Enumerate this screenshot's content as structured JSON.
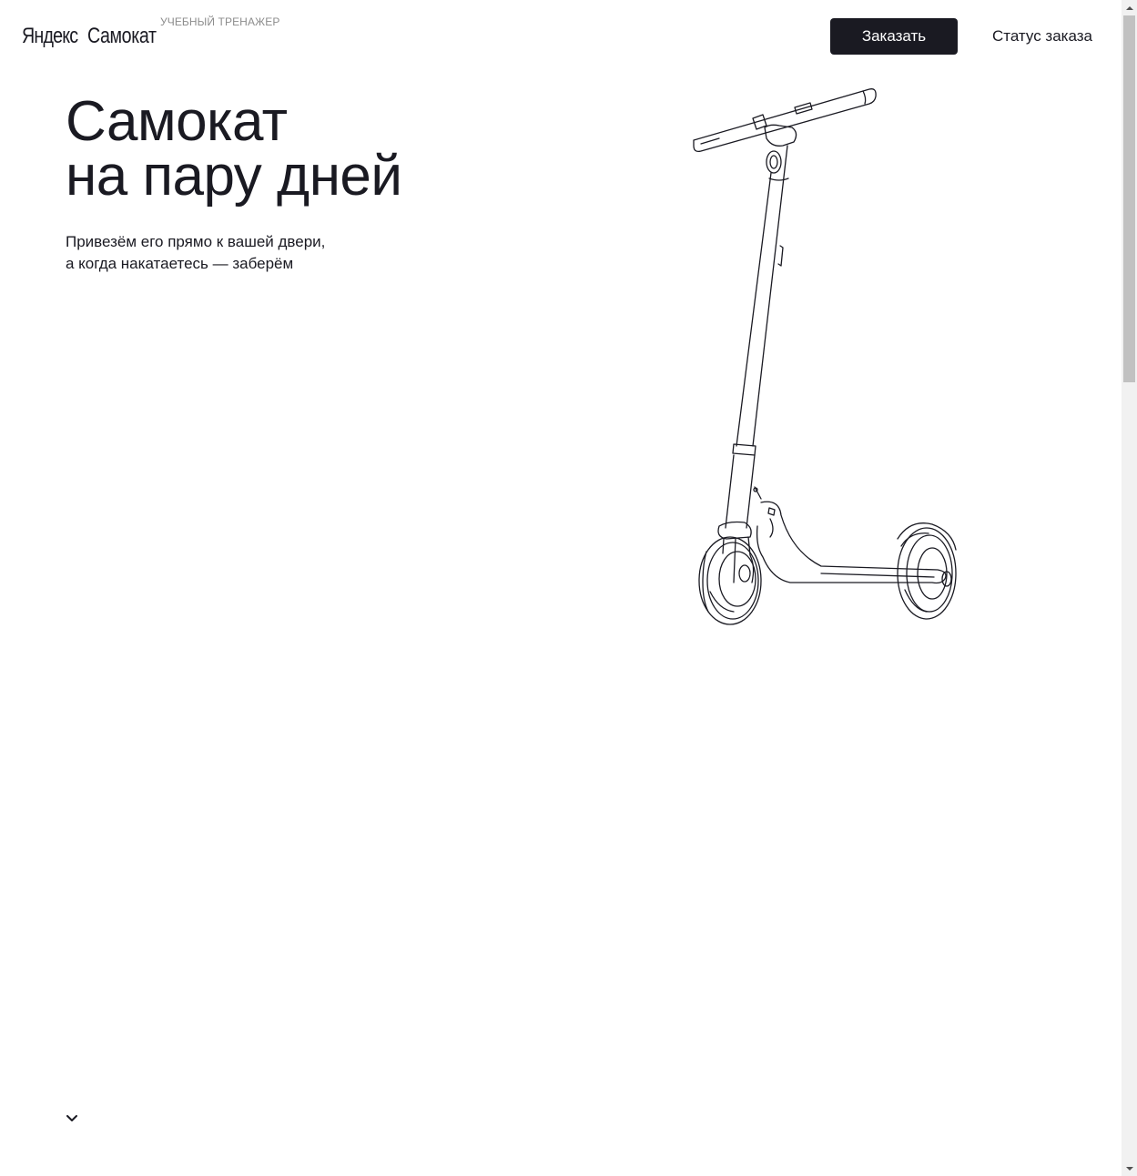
{
  "header": {
    "logo_brand": "Яндекс",
    "logo_product": "Самокат",
    "logo_subtitle": "УЧЕБНЫЙ ТРЕНАЖЕР",
    "order_button": "Заказать",
    "status_button": "Статус заказа"
  },
  "hero": {
    "title_line1": "Самокат",
    "title_line2": "на пару дней",
    "subtitle_line1": "Привезём его прямо к вашей двери,",
    "subtitle_line2": "а когда накатаетесь — заберём"
  },
  "icons": {
    "scroll_down": "chevron-down-icon",
    "illustration": "scooter-illustration"
  },
  "colors": {
    "primary": "#1a1a22",
    "background": "#ffffff",
    "muted": "#8c8c8c"
  }
}
